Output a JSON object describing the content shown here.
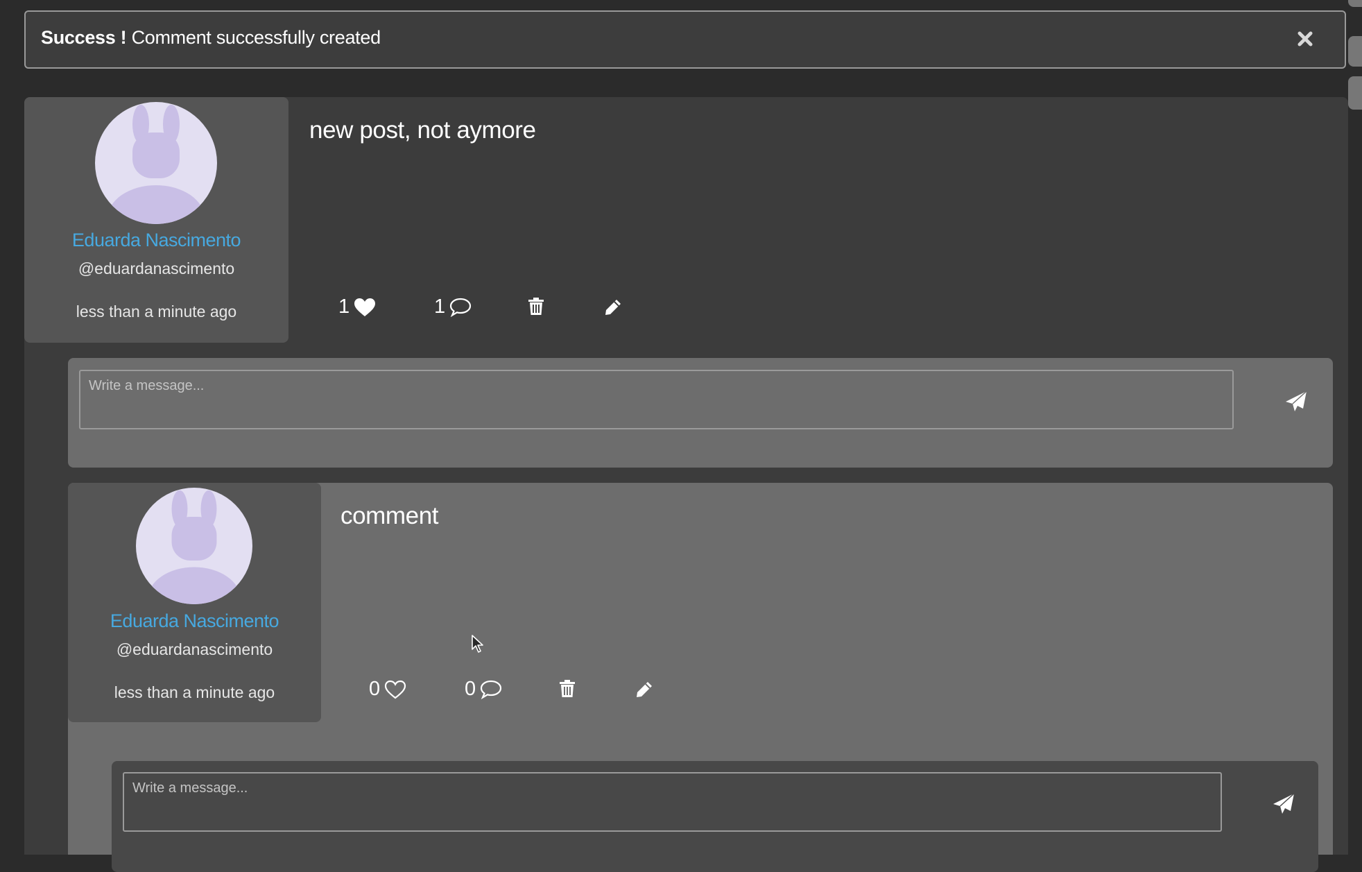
{
  "alert": {
    "strong": "Success !",
    "message": " Comment successfully created",
    "close_icon": "close-icon"
  },
  "post": {
    "author": {
      "name": "Eduarda Nascimento",
      "handle": "@eduardanascimento",
      "time": "less than a minute ago",
      "avatar_icon": "bunny-avatar"
    },
    "text": "new post, not aymore",
    "likes": "1",
    "liked": true,
    "comments": "1",
    "composer_placeholder": "Write a message..."
  },
  "comment": {
    "author": {
      "name": "Eduarda Nascimento",
      "handle": "@eduardanascimento",
      "time": "less than a minute ago",
      "avatar_icon": "bunny-avatar"
    },
    "text": "comment",
    "likes": "0",
    "liked": false,
    "comments": "0",
    "composer_placeholder": "Write a message..."
  },
  "colors": {
    "accent_name": "#47a9e0",
    "page_bg": "#2b2b2b",
    "card_bg": "#3c3c3c",
    "comment_bg": "#6d6d6d",
    "avatar_bg": "#e3dff2",
    "avatar_figure": "#c9bfe6"
  }
}
